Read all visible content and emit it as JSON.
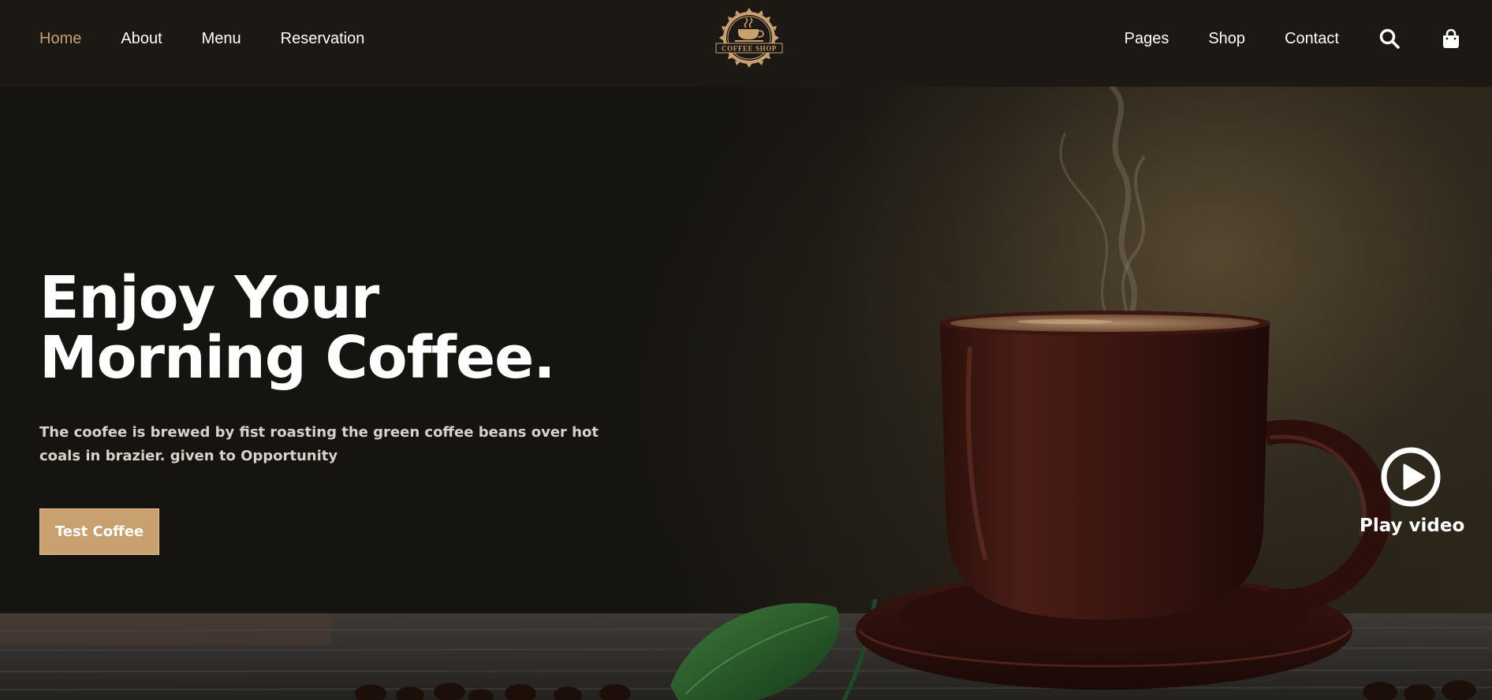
{
  "nav": {
    "left_links": [
      {
        "label": "Home",
        "active": true
      },
      {
        "label": "About",
        "active": false
      },
      {
        "label": "Menu",
        "active": false
      },
      {
        "label": "Reservation",
        "active": false
      }
    ],
    "right_links": [
      {
        "label": "Pages"
      },
      {
        "label": "Shop"
      },
      {
        "label": "Contact"
      }
    ],
    "icons": [
      "search-icon",
      "shopping-bag-icon"
    ],
    "logo_text": "COFFEE SHOP"
  },
  "hero": {
    "title": "Enjoy Your Morning Coffee.",
    "description": "The coofee is brewed by fist roasting the green coffee beans over hot coals in brazier. given to Opportunity",
    "cta_label": "Test Coffee",
    "play_label": "Play video"
  },
  "colors": {
    "accent": "#c9a06f",
    "nav_background": "#1c1814",
    "hero_background": "#161411",
    "text": "#ffffff"
  }
}
